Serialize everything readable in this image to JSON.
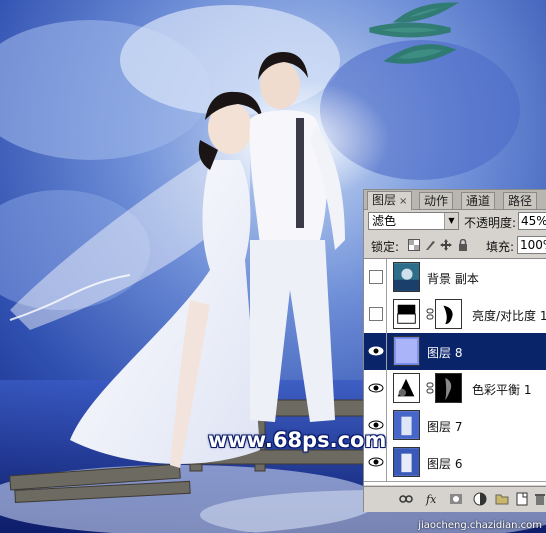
{
  "watermark": {
    "text": "www.68ps.com"
  },
  "credit": {
    "text": "jiaocheng.chazidian.com"
  },
  "panel": {
    "tabs": [
      {
        "label": "图层",
        "close": "×"
      },
      {
        "label": "动作"
      },
      {
        "label": "通道"
      },
      {
        "label": "路径"
      }
    ],
    "blend_mode": "滤色",
    "opacity_label": "不透明度:",
    "opacity_value": "45%",
    "lock_label": "锁定:",
    "fill_label": "填充:",
    "fill_value": "100%",
    "layers": [
      {
        "name": "背景 副本",
        "visible": false,
        "selected": false,
        "type": "photo"
      },
      {
        "name": "亮度/对比度 1",
        "visible": false,
        "selected": false,
        "type": "adjustment"
      },
      {
        "name": "图层 8",
        "visible": true,
        "selected": true,
        "type": "blue"
      },
      {
        "name": "色彩平衡 1",
        "visible": true,
        "selected": false,
        "type": "adjustment"
      },
      {
        "name": "图层 7",
        "visible": true,
        "selected": false,
        "type": "photo"
      },
      {
        "name": "图层 6",
        "visible": true,
        "selected": false,
        "type": "photo"
      }
    ],
    "bottom_icons": [
      "link-icon",
      "fx-icon",
      "mask-icon",
      "adjustment-icon",
      "folder-icon",
      "new-layer-icon",
      "trash-icon"
    ]
  }
}
